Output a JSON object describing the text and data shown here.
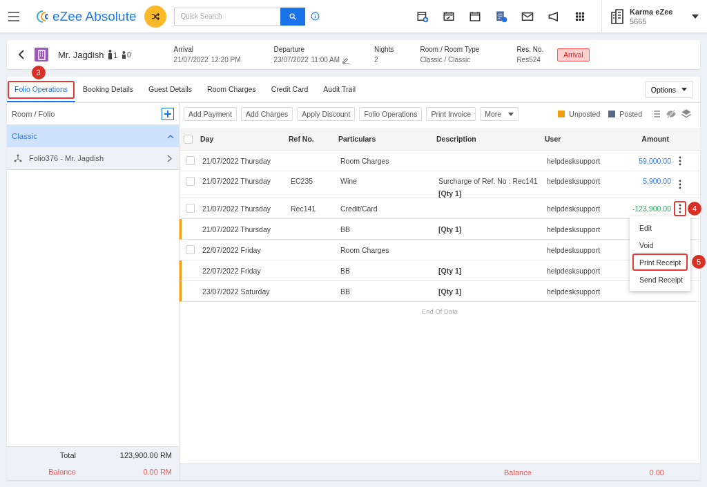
{
  "topbar": {
    "brand": "eZee Absolute",
    "search": {
      "placeholder": "Quick Search"
    },
    "property": {
      "name": "Karma eZee",
      "code": "5665"
    }
  },
  "guest": {
    "name": "Mr. Jagdish",
    "adults": "1",
    "children": "0",
    "fields": [
      {
        "label": "Arrival",
        "value": "21/07/2022",
        "time": "12:20 PM",
        "editable": false
      },
      {
        "label": "Departure",
        "value": "23/07/2022",
        "time": "11:00 AM",
        "editable": true
      },
      {
        "label": "Nights",
        "value": "2",
        "editable": false
      },
      {
        "label": "Room / Room Type",
        "value": "Classic / Classic",
        "editable": false
      },
      {
        "label": "Res. No.",
        "value": "Res524",
        "editable": false
      }
    ],
    "status": "Arrival"
  },
  "tabs": [
    {
      "label": "Folio Operations",
      "selected": true,
      "callout": "3"
    },
    {
      "label": "Booking Details",
      "selected": false
    },
    {
      "label": "Guest Details",
      "selected": false
    },
    {
      "label": "Room Charges",
      "selected": false
    },
    {
      "label": "Credit Card",
      "selected": false
    },
    {
      "label": "Audit Trail",
      "selected": false
    }
  ],
  "options_button": "Options",
  "sidebar": {
    "title": "Room / Folio",
    "items": [
      {
        "label": "Classic",
        "expanded": true,
        "children": [
          {
            "label": "Folio376 - Mr. Jagdish"
          }
        ]
      }
    ],
    "total_label": "Total",
    "total": "123,900.00 RM",
    "balance_label": "Balance",
    "balance": "0.00 RM"
  },
  "toolbar": {
    "buttons": [
      {
        "label": "Add Payment",
        "kind": "plain"
      },
      {
        "label": "Add Charges",
        "kind": "plain"
      },
      {
        "label": "Apply Discount",
        "kind": "plain"
      },
      {
        "label": "Folio Operations",
        "kind": "plain"
      },
      {
        "label": "Print Invoice",
        "kind": "plain"
      },
      {
        "label": "More",
        "kind": "dropdown"
      }
    ],
    "legend": [
      {
        "label": "Unposted",
        "color": "#f39c12"
      },
      {
        "label": "Posted",
        "color": "#566884"
      }
    ]
  },
  "table": {
    "select_all_checked": false,
    "columns": [
      "Day",
      "Ref No.",
      "Particulars",
      "Description",
      "User",
      "Amount"
    ],
    "rows": [
      {
        "kind": "posted",
        "checked": false,
        "day": "21/07/2022 Thursday",
        "ref": "",
        "particulars": "Room Charges",
        "description": "",
        "qty": "",
        "user": "helpdesksupport",
        "amount": "59,000.00",
        "color": "#3a7be0",
        "menu_open": false
      },
      {
        "kind": "posted",
        "checked": false,
        "day": "21/07/2022 Thursday",
        "ref": "EC235",
        "particulars": "Wine",
        "description": "Surcharge of Ref. No : Rec141",
        "qty": "[Qty 1]",
        "user": "helpdesksupport",
        "amount": "5,900.00",
        "color": "#3a7be0",
        "menu_open": false
      },
      {
        "kind": "posted",
        "checked": false,
        "day": "21/07/2022 Thursday",
        "ref": "Rec141",
        "particulars": "Credit/Card",
        "description": "",
        "qty": "",
        "user": "helpdesksupport",
        "amount": "-123,900.00",
        "color": "#2eaa58",
        "menu_open": true,
        "callout": "4"
      },
      {
        "kind": "unposted",
        "day": "21/07/2022 Thursday",
        "ref": "",
        "particulars": "BB",
        "description": "",
        "qty": "[Qty 1]",
        "user": "helpdesksupport"
      },
      {
        "kind": "posted",
        "checked": false,
        "day": "22/07/2022 Friday",
        "ref": "",
        "particulars": "Room Charges",
        "description": "",
        "qty": "",
        "user": "helpdesksupport"
      },
      {
        "kind": "unposted",
        "day": "22/07/2022 Friday",
        "ref": "",
        "particulars": "BB",
        "description": "",
        "qty": "[Qty 1]",
        "user": "helpdesksupport"
      },
      {
        "kind": "unposted",
        "day": "23/07/2022 Saturday",
        "ref": "",
        "particulars": "BB",
        "description": "",
        "qty": "[Qty 1]",
        "user": "helpdesksupport"
      }
    ],
    "end_text": "End Of Data",
    "balance_label": "Balance",
    "balance": "0.00"
  },
  "row_menu": [
    {
      "label": "Edit",
      "highlighted": false
    },
    {
      "label": "Void",
      "highlighted": false
    },
    {
      "label": "Print Receipt",
      "highlighted": true,
      "callout": "5"
    },
    {
      "label": "Send Receipt",
      "highlighted": false
    }
  ]
}
